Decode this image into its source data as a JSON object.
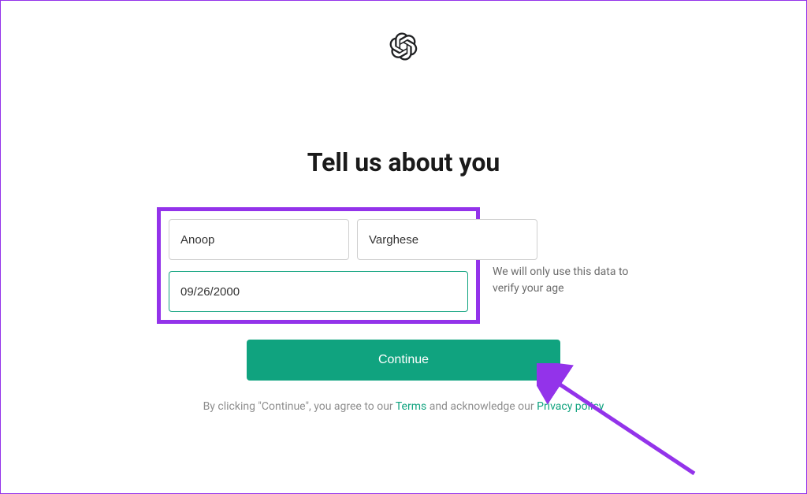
{
  "heading": "Tell us about you",
  "form": {
    "first_name": "Anoop",
    "last_name": "Varghese",
    "birthday": "09/26/2000",
    "helper_text": "We will only use this data to verify your age"
  },
  "continue_button_label": "Continue",
  "disclaimer": {
    "prefix": "By clicking \"Continue\", you agree to our ",
    "terms_label": "Terms",
    "middle": " and acknowledge our ",
    "privacy_label": "Privacy policy"
  }
}
